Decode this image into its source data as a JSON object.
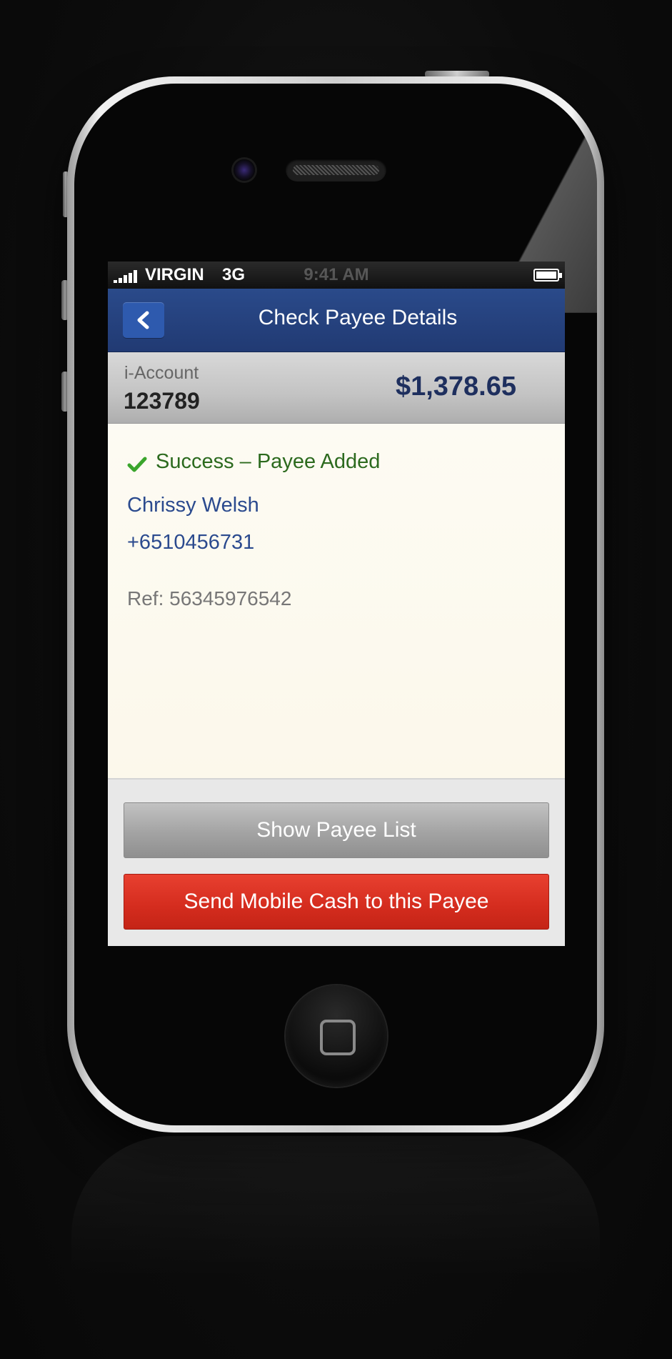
{
  "status_bar": {
    "carrier": "VIRGIN",
    "network": "3G",
    "time": "9:41 AM",
    "signal_bars": 5,
    "battery_icon": "battery-icon"
  },
  "nav": {
    "back_icon": "chevron-left-icon",
    "title": "Check Payee Details"
  },
  "account": {
    "label": "i-Account",
    "number": "123789",
    "balance": "$1,378.65"
  },
  "result": {
    "icon": "checkmark-icon",
    "status": "Success – Payee Added",
    "payee_name": "Chrissy Welsh",
    "payee_phone": "+6510456731",
    "reference": "Ref: 56345976542"
  },
  "actions": {
    "show_list": "Show Payee List",
    "send_cash": "Send Mobile Cash to this Payee"
  },
  "colors": {
    "nav_blue": "#213a73",
    "back_button_blue": "#2e5aae",
    "balance_text": "#1e2f5e",
    "success_green": "#2c6a1e",
    "check_green": "#3aa52c",
    "payee_blue": "#2b4a8e",
    "send_button_red": "#d42c1e",
    "list_button_grey": "#a3a3a3",
    "content_cream": "#fcf8eb"
  }
}
